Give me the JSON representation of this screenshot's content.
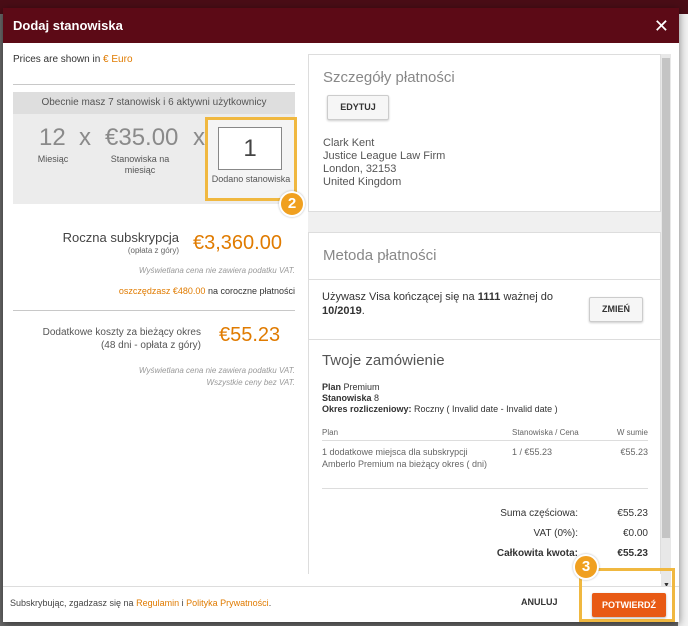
{
  "modal": {
    "title": "Dodaj stanowiska",
    "close_symbol": "✕"
  },
  "left": {
    "prices_shown_prefix": "Prices are shown in",
    "currency": "€ Euro",
    "current_seats": "Obecnie masz 7 stanowisk i 6 aktywni użytkownicy",
    "months": "12",
    "months_label": "Miesiąc",
    "times": "x",
    "price_per_seat": "€35.00",
    "price_per_seat_label": "Stanowiska na miesiąc",
    "quantity": "1",
    "quantity_label": "Dodano stanowiska",
    "annual_label": "Roczna subskrypcja",
    "annual_sub": "(opłata z góry)",
    "annual_price": "€3,360.00",
    "vat_note": "Wyświetlana cena nie zawiera podatku VAT.",
    "savings_amount": "oszczędzasz €480.00",
    "savings_suffix": "na coroczne płatności",
    "extra_label": "Dodatkowe koszty za bieżący okres",
    "extra_sub": "(48 dni - opłata z góry)",
    "extra_price": "€55.23",
    "vat_note2": "Wyświetlana cena nie zawiera podatku VAT.",
    "vat_note3": "Wszystkie ceny bez VAT."
  },
  "badges": {
    "step2": "2",
    "step3": "3"
  },
  "billing": {
    "title": "Szczegóły płatności",
    "edit_button": "EDYTUJ",
    "address": [
      "Clark Kent",
      "Justice League Law Firm",
      "London, 32153",
      "United Kingdom"
    ]
  },
  "payment": {
    "title": "Metoda płatności",
    "text_prefix": "Używasz Visa kończącej się na",
    "card_digits": "1111",
    "text_middle": "ważnej do",
    "expiry": "10/2019",
    "text_end": ".",
    "change_button": "ZMIEŃ"
  },
  "order": {
    "title": "Twoje zamówienie",
    "plan_key": "Plan",
    "plan_value": "Premium",
    "seats_key": "Stanowiska",
    "seats_value": "8",
    "period_key": "Okres rozliczeniowy:",
    "period_value": "Roczny ( Invalid date - Invalid date )",
    "col_plan": "Plan",
    "col_seats_price": "Stanowiska / Cena",
    "col_total": "W sumie",
    "item_desc": "1 dodatkowe miejsca dla subskrypcji Amberlo Premium na bieżący okres ( dni)",
    "item_qty_price": "1 / €55.23",
    "item_total": "€55.23",
    "subtotal_label": "Suma częściowa:",
    "subtotal_value": "€55.23",
    "vat_label": "VAT (0%):",
    "vat_value": "€0.00",
    "total_label": "Całkowita kwota:",
    "total_value": "€55.23"
  },
  "footer": {
    "text_prefix": "Subskrybując, zgadzasz się na",
    "terms_link": "Regulamin",
    "conj": "i",
    "privacy_link": "Polityka Prywatności",
    "text_end": ".",
    "cancel": "ANULUJ",
    "confirm": "POTWIERDŹ"
  }
}
